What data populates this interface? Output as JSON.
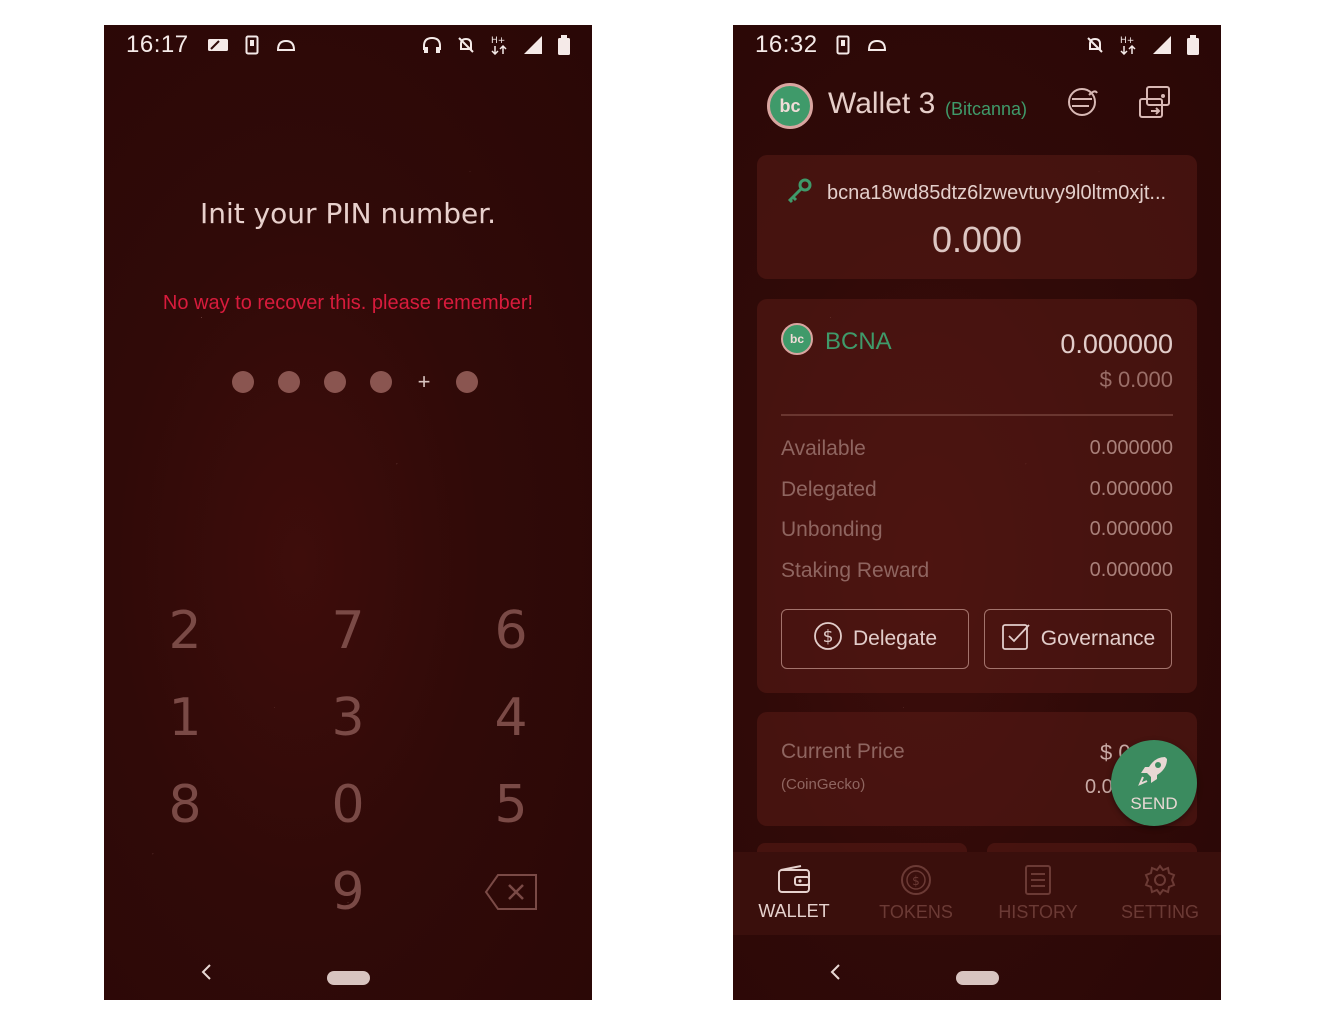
{
  "left_screen": {
    "status_bar": {
      "time": "16:17"
    },
    "title": "Init your PIN number.",
    "warning": "No way to recover this. please remember!",
    "pin_indicator": {
      "filled_dots": 5,
      "plus_symbol": "+"
    },
    "keypad": {
      "keys": [
        "2",
        "7",
        "6",
        "1",
        "3",
        "4",
        "8",
        "0",
        "5",
        "9"
      ],
      "backspace_icon": "backspace-icon"
    }
  },
  "right_screen": {
    "status_bar": {
      "time": "16:32"
    },
    "header": {
      "wallet_name": "Wallet 3",
      "chain": "(Bitcanna)",
      "logo_text": "bc"
    },
    "address_card": {
      "address": "bcna18wd85dtz6lzwevtuvy9l0ltm0xjt...",
      "balance": "0.000"
    },
    "balance_card": {
      "token_logo_text": "bc",
      "token": "BCNA",
      "amount": "0.000000",
      "usd_value": "$ 0.000",
      "stats": [
        {
          "label": "Available",
          "value": "0.000000"
        },
        {
          "label": "Delegated",
          "value": "0.000000"
        },
        {
          "label": "Unbonding",
          "value": "0.000000"
        },
        {
          "label": "Staking Reward",
          "value": "0.000000"
        }
      ],
      "delegate_label": "Delegate",
      "governance_label": "Governance"
    },
    "price_card": {
      "label": "Current Price",
      "source": "(CoinGecko)",
      "usd_prefix": "$ 0",
      "value": "0.00"
    },
    "send_button": {
      "label": "SEND"
    },
    "bottom_tabs": [
      {
        "label": "WALLET",
        "active": true
      },
      {
        "label": "TOKENS",
        "active": false
      },
      {
        "label": "HISTORY",
        "active": false
      },
      {
        "label": "SETTING",
        "active": false
      }
    ]
  },
  "colors": {
    "background": "#300a08",
    "accent_green": "#3f9a6a",
    "warning_red": "#d81b3c"
  }
}
